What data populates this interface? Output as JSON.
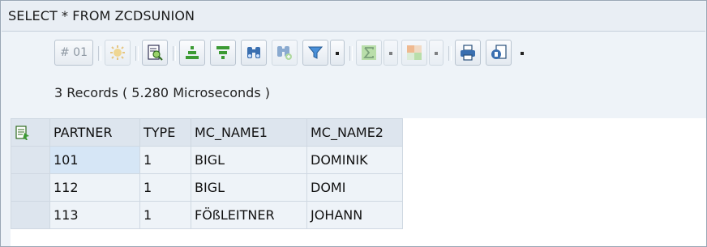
{
  "window": {
    "title": "SELECT * FROM ZCDSUNION"
  },
  "toolbar": {
    "number_label": "# 01",
    "icons": [
      "settings-icon",
      "details-icon",
      "sort-ascending-icon",
      "sort-descending-icon",
      "find-icon",
      "find-next-icon",
      "filter-icon",
      "filter-dropdown-icon",
      "sum-icon",
      "sum-dropdown-icon",
      "subtotal-icon",
      "subtotal-dropdown-icon",
      "print-icon",
      "export-icon",
      "export-dropdown-icon"
    ]
  },
  "status": {
    "text": "3 Records ( 5.280 Microseconds )"
  },
  "table": {
    "columns": [
      "PARTNER",
      "TYPE",
      "MC_NAME1",
      "MC_NAME2"
    ],
    "rows": [
      [
        "101",
        "1",
        "BIGL",
        "DOMINIK"
      ],
      [
        "112",
        "1",
        "BIGL",
        "DOMI"
      ],
      [
        "113",
        "1",
        "FÖßLEITNER",
        "JOHANN"
      ]
    ]
  },
  "colors": {
    "frame_bg": "#eef3f8",
    "header_bg": "#dde5ee",
    "selected_cell": "#d6e6f6",
    "accent_green": "#3c9a34"
  }
}
